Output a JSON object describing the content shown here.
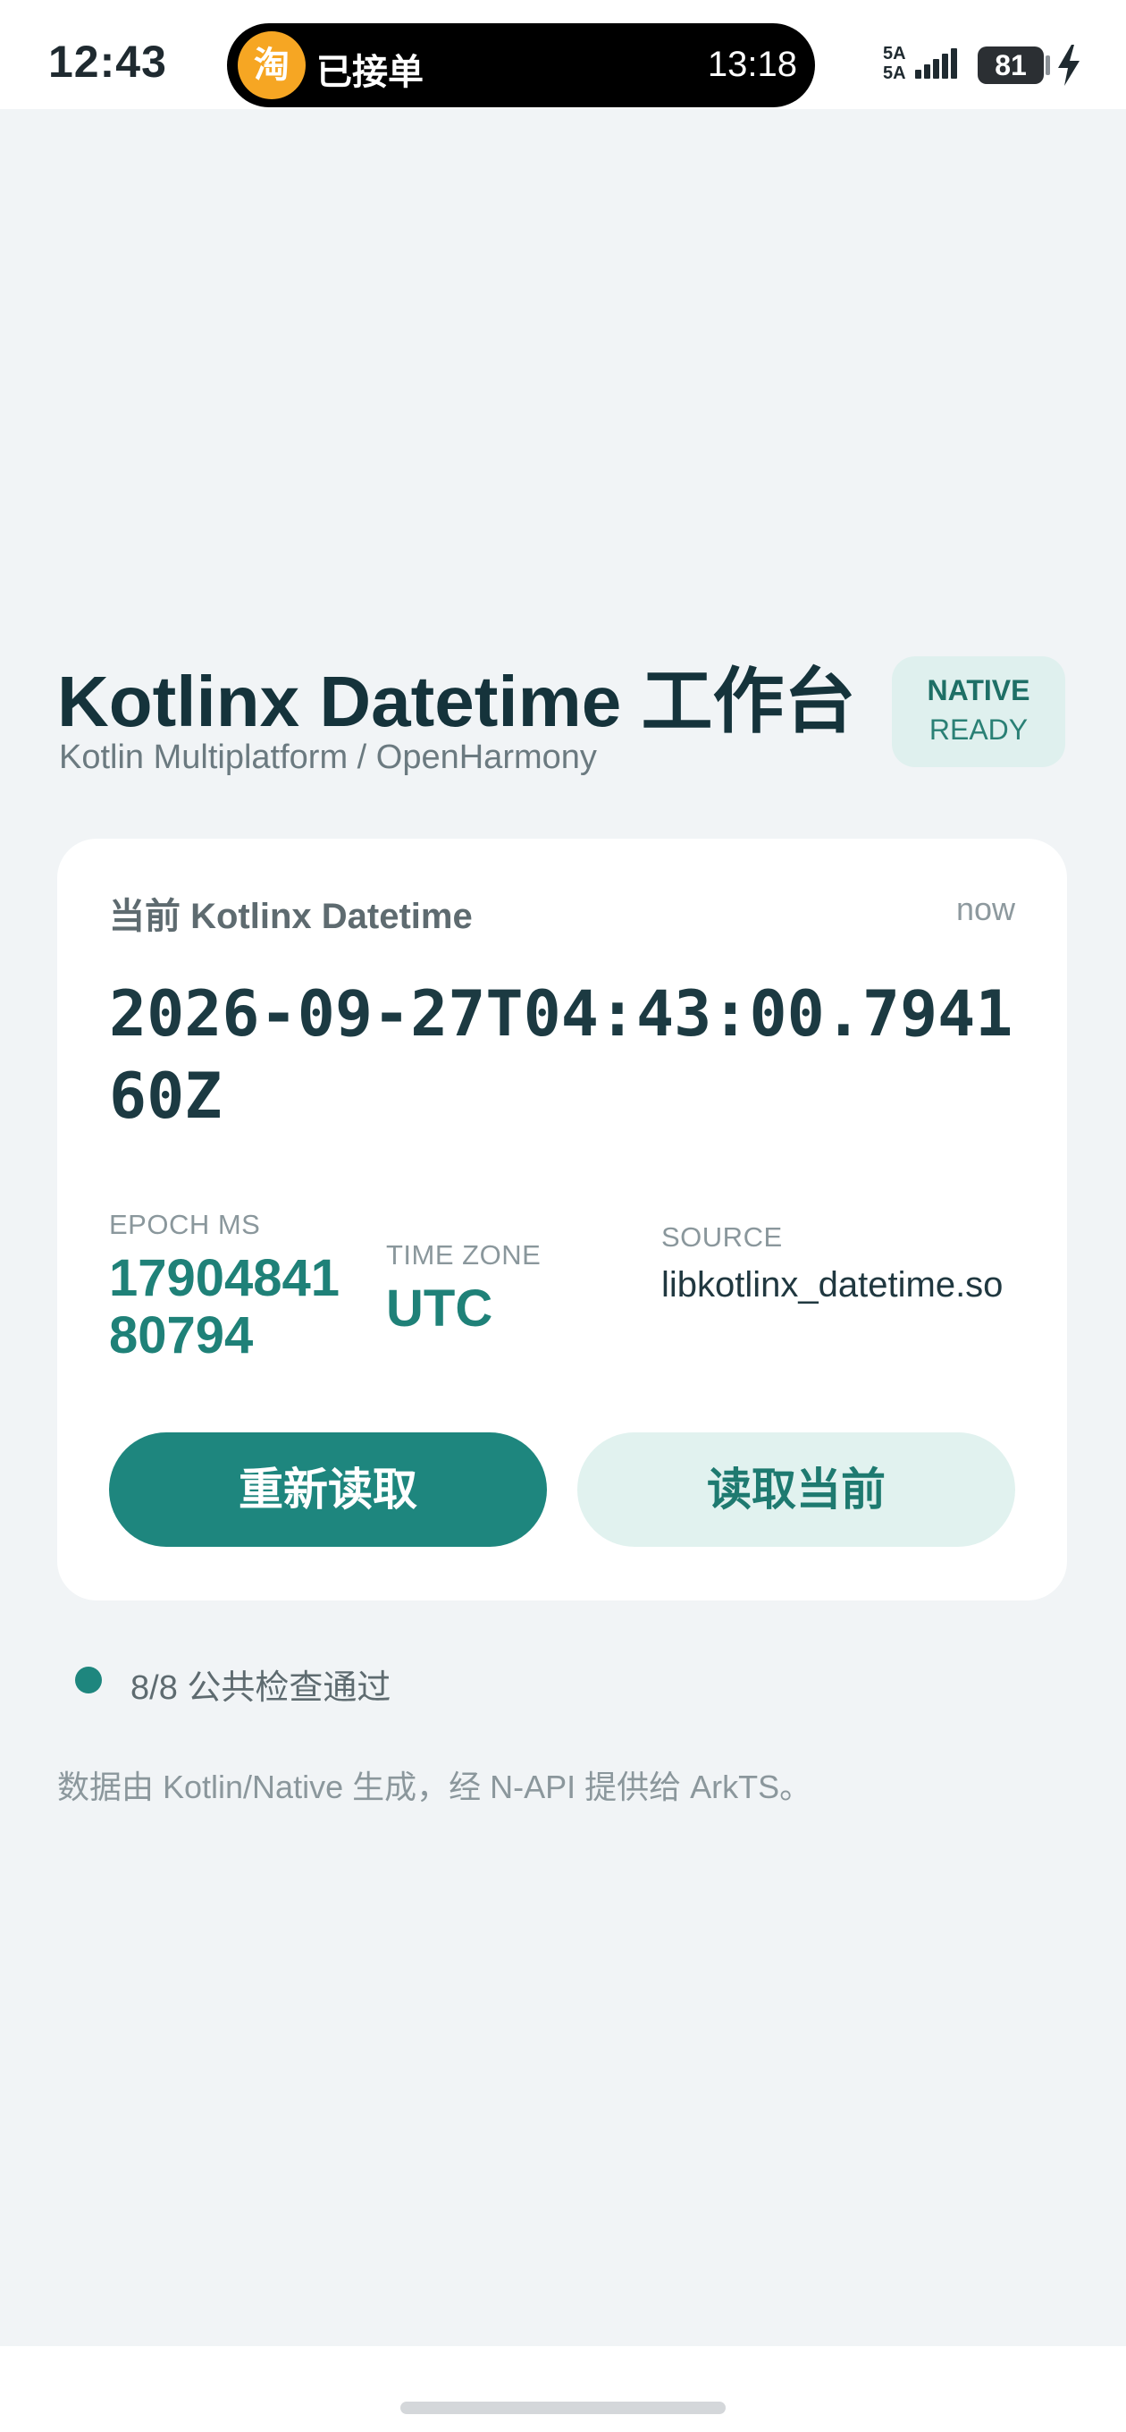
{
  "status_bar": {
    "time": "12:43",
    "live_activity": {
      "app_glyph": "淘",
      "text": "已接单",
      "time": "13:18"
    },
    "network": [
      "5A",
      "5A"
    ],
    "battery": "81"
  },
  "header": {
    "title": "Kotlinx Datetime 工作台",
    "subtitle": "Kotlin Multiplatform / OpenHarmony",
    "badge": {
      "line1": "NATIVE",
      "line2": "READY"
    }
  },
  "card": {
    "title": "当前 Kotlinx Datetime",
    "tag": "now",
    "iso_value": "2026-09-27T04:43:00.794160Z",
    "epoch": {
      "label": "EPOCH MS",
      "value_line1": "17904841",
      "value_line2": "80794"
    },
    "timezone": {
      "label": "TIME ZONE",
      "value": "UTC"
    },
    "source": {
      "label": "SOURCE",
      "value": "libkotlinx_datetime.so"
    },
    "buttons": {
      "primary": "重新读取",
      "secondary": "读取当前"
    }
  },
  "status": {
    "text": "8/8 公共检查通过"
  },
  "footnote": "数据由 Kotlin/Native 生成，经 N-API 提供给 ArkTS。",
  "colors": {
    "accent": "#1e867e",
    "accent_light": "#e1f2ef",
    "title": "#15333b",
    "background": "#f1f4f6"
  }
}
